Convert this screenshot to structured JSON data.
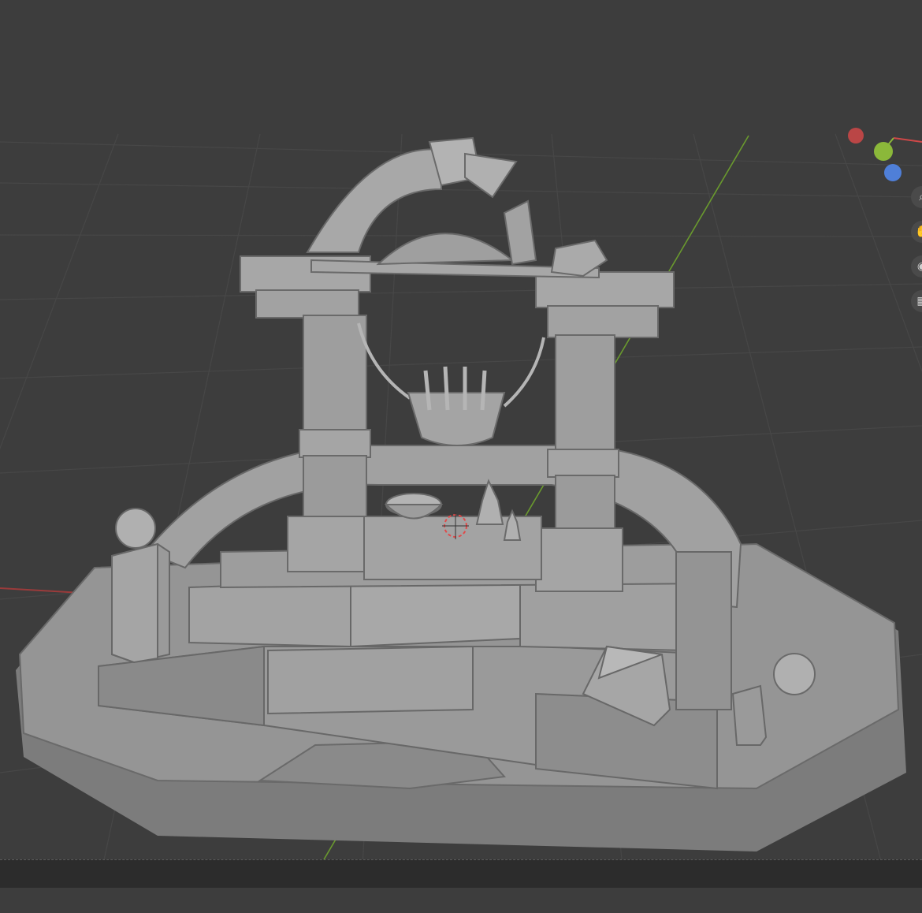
{
  "app": "3D viewport",
  "viewport": {
    "background": "#3d3d3d",
    "grid_color": "#4b4b4b",
    "x_axis_color": "#9b3b3b",
    "y_axis_color": "#6a9a2e",
    "model_color": "#8f8f8f"
  },
  "gizmo": {
    "x_color": "#d04848",
    "y_color": "#8bb83a",
    "z_color": "#4f7fd8"
  },
  "side_tools": [
    {
      "name": "zoom-icon"
    },
    {
      "name": "hand-pan-icon"
    },
    {
      "name": "camera-icon"
    },
    {
      "name": "grid-toggle-icon"
    }
  ]
}
